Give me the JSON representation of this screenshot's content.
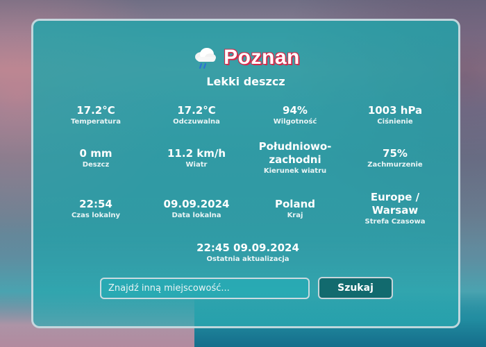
{
  "weather": {
    "city": "Poznan",
    "icon": "cloud-rain-icon",
    "description": "Lekki deszcz"
  },
  "stats": [
    {
      "value": "17.2°C",
      "label": "Temperatura"
    },
    {
      "value": "17.2°C",
      "label": "Odczuwalna"
    },
    {
      "value": "94%",
      "label": "Wilgotność"
    },
    {
      "value": "1003 hPa",
      "label": "Ciśnienie"
    },
    {
      "value": "0 mm",
      "label": "Deszcz"
    },
    {
      "value": "11.2 km/h",
      "label": "Wiatr"
    },
    {
      "value": "Południowo-zachodni",
      "label": "Kierunek wiatru"
    },
    {
      "value": "75%",
      "label": "Zachmurzenie"
    },
    {
      "value": "22:54",
      "label": "Czas lokalny"
    },
    {
      "value": "09.09.2024",
      "label": "Data lokalna"
    },
    {
      "value": "Poland",
      "label": "Kraj"
    },
    {
      "value": "Europe / Warsaw",
      "label": "Strefa Czasowa"
    }
  ],
  "last_update": {
    "value": "22:45 09.09.2024",
    "label": "Ostatnia aktualizacja"
  },
  "search": {
    "placeholder": "Znajdź inną miejscowość...",
    "value": "",
    "button_label": "Szukaj"
  },
  "colors": {
    "card_bg": "#1fa5aa",
    "accent_red": "#d62a4a",
    "button_bg": "#126a6e"
  }
}
